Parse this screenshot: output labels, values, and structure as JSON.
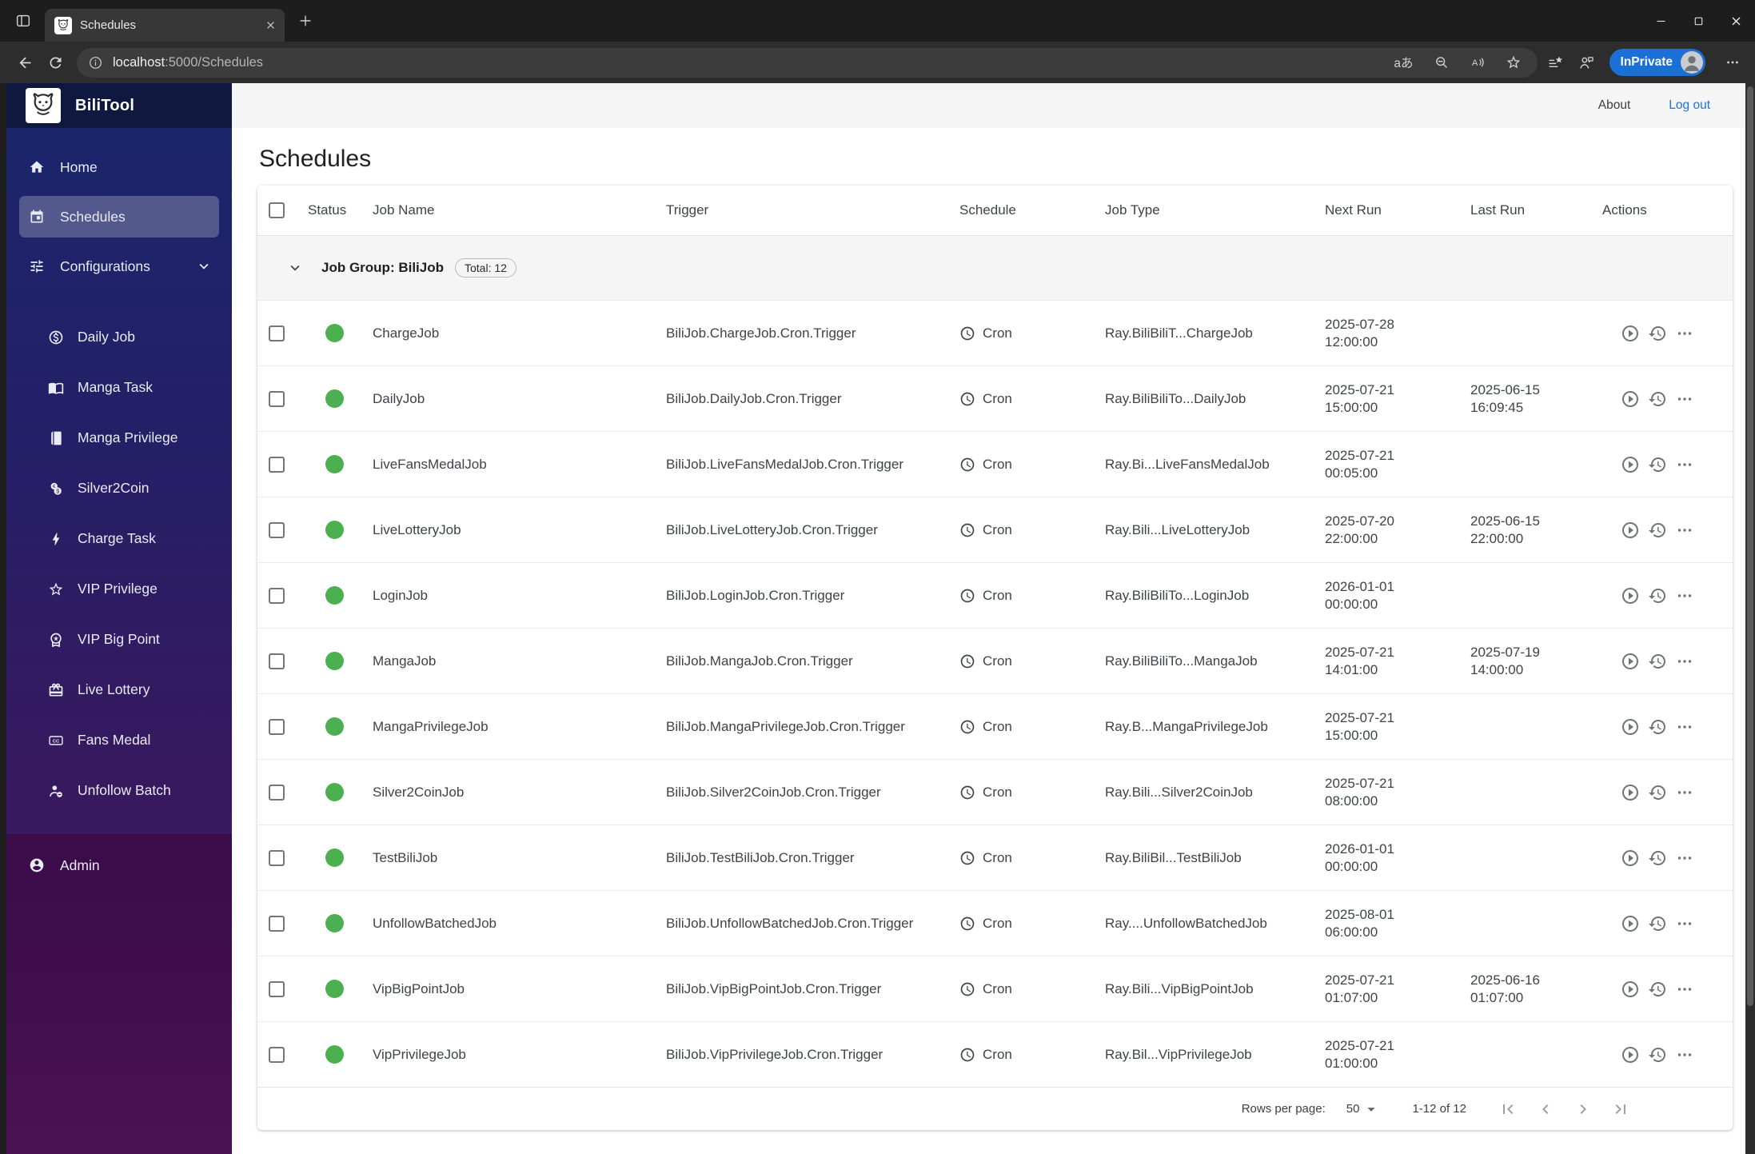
{
  "browser": {
    "tab_title": "Schedules",
    "url_domain": "localhost",
    "url_path": ":5000/Schedules",
    "translate_label": "aあ",
    "inprivate_label": "InPrivate"
  },
  "app_bar": {
    "about_label": "About",
    "logout_label": "Log out"
  },
  "sidebar": {
    "brand": "BiliTool",
    "main_items": [
      {
        "icon": "home-icon",
        "label": "Home",
        "selected": false
      },
      {
        "icon": "calendar-icon",
        "label": "Schedules",
        "selected": true
      },
      {
        "icon": "tune-icon",
        "label": "Configurations",
        "selected": false,
        "chevron": true
      }
    ],
    "config_items": [
      {
        "icon": "coin-icon",
        "label": "Daily Job"
      },
      {
        "icon": "book-open-icon",
        "label": "Manga Task"
      },
      {
        "icon": "book-icon",
        "label": "Manga Privilege"
      },
      {
        "icon": "coins-icon",
        "label": "Silver2Coin"
      },
      {
        "icon": "bolt-icon",
        "label": "Charge Task"
      },
      {
        "icon": "star-icon",
        "label": "VIP Privilege"
      },
      {
        "icon": "medal-icon",
        "label": "VIP Big Point"
      },
      {
        "icon": "gift-icon",
        "label": "Live Lottery"
      },
      {
        "icon": "cc-icon",
        "label": "Fans Medal"
      },
      {
        "icon": "person-remove-icon",
        "label": "Unfollow Batch"
      }
    ],
    "admin_item": {
      "icon": "account-circle-icon",
      "label": "Admin"
    }
  },
  "page": {
    "title": "Schedules"
  },
  "table": {
    "headers": [
      "Status",
      "Job Name",
      "Trigger",
      "Schedule",
      "Job Type",
      "Next Run",
      "Last Run",
      "Actions"
    ],
    "group": {
      "label": "Job Group: BiliJob",
      "badge": "Total: 12"
    },
    "status_color": "#4caf50",
    "row_action_icons": [
      "run-now-icon",
      "history-icon",
      "more-actions-icon"
    ],
    "rows": [
      {
        "job_name": "ChargeJob",
        "trigger": "BiliJob.ChargeJob.Cron.Trigger",
        "schedule": "Cron",
        "job_type": "Ray.BiliBiliT...ChargeJob",
        "next_run_date": "2025-07-28",
        "next_run_time": "12:00:00",
        "last_run_date": "",
        "last_run_time": ""
      },
      {
        "job_name": "DailyJob",
        "trigger": "BiliJob.DailyJob.Cron.Trigger",
        "schedule": "Cron",
        "job_type": "Ray.BiliBiliTo...DailyJob",
        "next_run_date": "2025-07-21",
        "next_run_time": "15:00:00",
        "last_run_date": "2025-06-15",
        "last_run_time": "16:09:45"
      },
      {
        "job_name": "LiveFansMedalJob",
        "trigger": "BiliJob.LiveFansMedalJob.Cron.Trigger",
        "schedule": "Cron",
        "job_type": "Ray.Bi...LiveFansMedalJob",
        "next_run_date": "2025-07-21",
        "next_run_time": "00:05:00",
        "last_run_date": "",
        "last_run_time": ""
      },
      {
        "job_name": "LiveLotteryJob",
        "trigger": "BiliJob.LiveLotteryJob.Cron.Trigger",
        "schedule": "Cron",
        "job_type": "Ray.Bili...LiveLotteryJob",
        "next_run_date": "2025-07-20",
        "next_run_time": "22:00:00",
        "last_run_date": "2025-06-15",
        "last_run_time": "22:00:00"
      },
      {
        "job_name": "LoginJob",
        "trigger": "BiliJob.LoginJob.Cron.Trigger",
        "schedule": "Cron",
        "job_type": "Ray.BiliBiliTo...LoginJob",
        "next_run_date": "2026-01-01",
        "next_run_time": "00:00:00",
        "last_run_date": "",
        "last_run_time": ""
      },
      {
        "job_name": "MangaJob",
        "trigger": "BiliJob.MangaJob.Cron.Trigger",
        "schedule": "Cron",
        "job_type": "Ray.BiliBiliTo...MangaJob",
        "next_run_date": "2025-07-21",
        "next_run_time": "14:01:00",
        "last_run_date": "2025-07-19",
        "last_run_time": "14:00:00"
      },
      {
        "job_name": "MangaPrivilegeJob",
        "trigger": "BiliJob.MangaPrivilegeJob.Cron.Trigger",
        "schedule": "Cron",
        "job_type": "Ray.B...MangaPrivilegeJob",
        "next_run_date": "2025-07-21",
        "next_run_time": "15:00:00",
        "last_run_date": "",
        "last_run_time": ""
      },
      {
        "job_name": "Silver2CoinJob",
        "trigger": "BiliJob.Silver2CoinJob.Cron.Trigger",
        "schedule": "Cron",
        "job_type": "Ray.Bili...Silver2CoinJob",
        "next_run_date": "2025-07-21",
        "next_run_time": "08:00:00",
        "last_run_date": "",
        "last_run_time": ""
      },
      {
        "job_name": "TestBiliJob",
        "trigger": "BiliJob.TestBiliJob.Cron.Trigger",
        "schedule": "Cron",
        "job_type": "Ray.BiliBil...TestBiliJob",
        "next_run_date": "2026-01-01",
        "next_run_time": "00:00:00",
        "last_run_date": "",
        "last_run_time": ""
      },
      {
        "job_name": "UnfollowBatchedJob",
        "trigger": "BiliJob.UnfollowBatchedJob.Cron.Trigger",
        "schedule": "Cron",
        "job_type": "Ray....UnfollowBatchedJob",
        "next_run_date": "2025-08-01",
        "next_run_time": "06:00:00",
        "last_run_date": "",
        "last_run_time": ""
      },
      {
        "job_name": "VipBigPointJob",
        "trigger": "BiliJob.VipBigPointJob.Cron.Trigger",
        "schedule": "Cron",
        "job_type": "Ray.Bili...VipBigPointJob",
        "next_run_date": "2025-07-21",
        "next_run_time": "01:07:00",
        "last_run_date": "2025-06-16",
        "last_run_time": "01:07:00"
      },
      {
        "job_name": "VipPrivilegeJob",
        "trigger": "BiliJob.VipPrivilegeJob.Cron.Trigger",
        "schedule": "Cron",
        "job_type": "Ray.Bil...VipPrivilegeJob",
        "next_run_date": "2025-07-21",
        "next_run_time": "01:00:00",
        "last_run_date": "",
        "last_run_time": ""
      }
    ]
  },
  "footer": {
    "rows_per_page_label": "Rows per page:",
    "rows_per_page_value": "50",
    "range_label": "1-12 of 12",
    "pager_icons": [
      "first-page-icon",
      "prev-page-icon",
      "next-page-icon",
      "last-page-icon"
    ]
  },
  "colors": {
    "link_blue": "#1a73e8",
    "status_green": "#4caf50",
    "inprivate_blue": "#1a70d4",
    "sidebar_top": "#1a276c",
    "sidebar_bottom": "#4a1253"
  }
}
